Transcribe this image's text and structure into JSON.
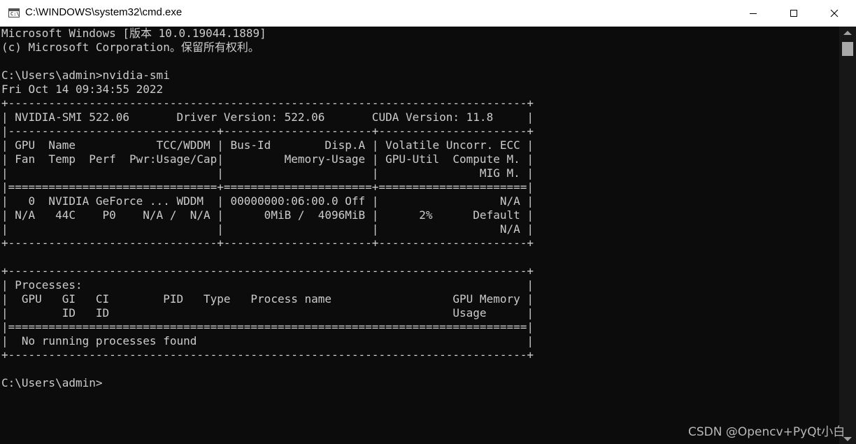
{
  "window": {
    "title": "C:\\WINDOWS\\system32\\cmd.exe",
    "icon_label": "C:\\",
    "controls": {
      "minimize": "minimize-icon",
      "maximize": "maximize-icon",
      "close": "close-icon"
    }
  },
  "colors": {
    "console_bg": "#0c0c0c",
    "console_fg": "#cccccc",
    "titlebar_bg": "#ffffff"
  },
  "console": {
    "lines": [
      "Microsoft Windows [版本 10.0.19044.1889]",
      "(c) Microsoft Corporation。保留所有权利。",
      "",
      "C:\\Users\\admin>nvidia-smi",
      "Fri Oct 14 09:34:55 2022",
      "+-----------------------------------------------------------------------------+",
      "| NVIDIA-SMI 522.06       Driver Version: 522.06       CUDA Version: 11.8     |",
      "|-------------------------------+----------------------+----------------------+",
      "| GPU  Name            TCC/WDDM | Bus-Id        Disp.A | Volatile Uncorr. ECC |",
      "| Fan  Temp  Perf  Pwr:Usage/Cap|         Memory-Usage | GPU-Util  Compute M. |",
      "|                               |                      |               MIG M. |",
      "|===============================+======================+======================|",
      "|   0  NVIDIA GeForce ... WDDM  | 00000000:06:00.0 Off |                  N/A |",
      "| N/A   44C    P0    N/A /  N/A |      0MiB /  4096MiB |      2%      Default |",
      "|                               |                      |                  N/A |",
      "+-------------------------------+----------------------+----------------------+",
      "",
      "+-----------------------------------------------------------------------------+",
      "| Processes:                                                                  |",
      "|  GPU   GI   CI        PID   Type   Process name                  GPU Memory |",
      "|        ID   ID                                                   Usage      |",
      "|=============================================================================|",
      "|  No running processes found                                                 |",
      "+-----------------------------------------------------------------------------+",
      "",
      "C:\\Users\\admin>"
    ]
  },
  "watermark": "CSDN @Opencv+PyQt小白"
}
